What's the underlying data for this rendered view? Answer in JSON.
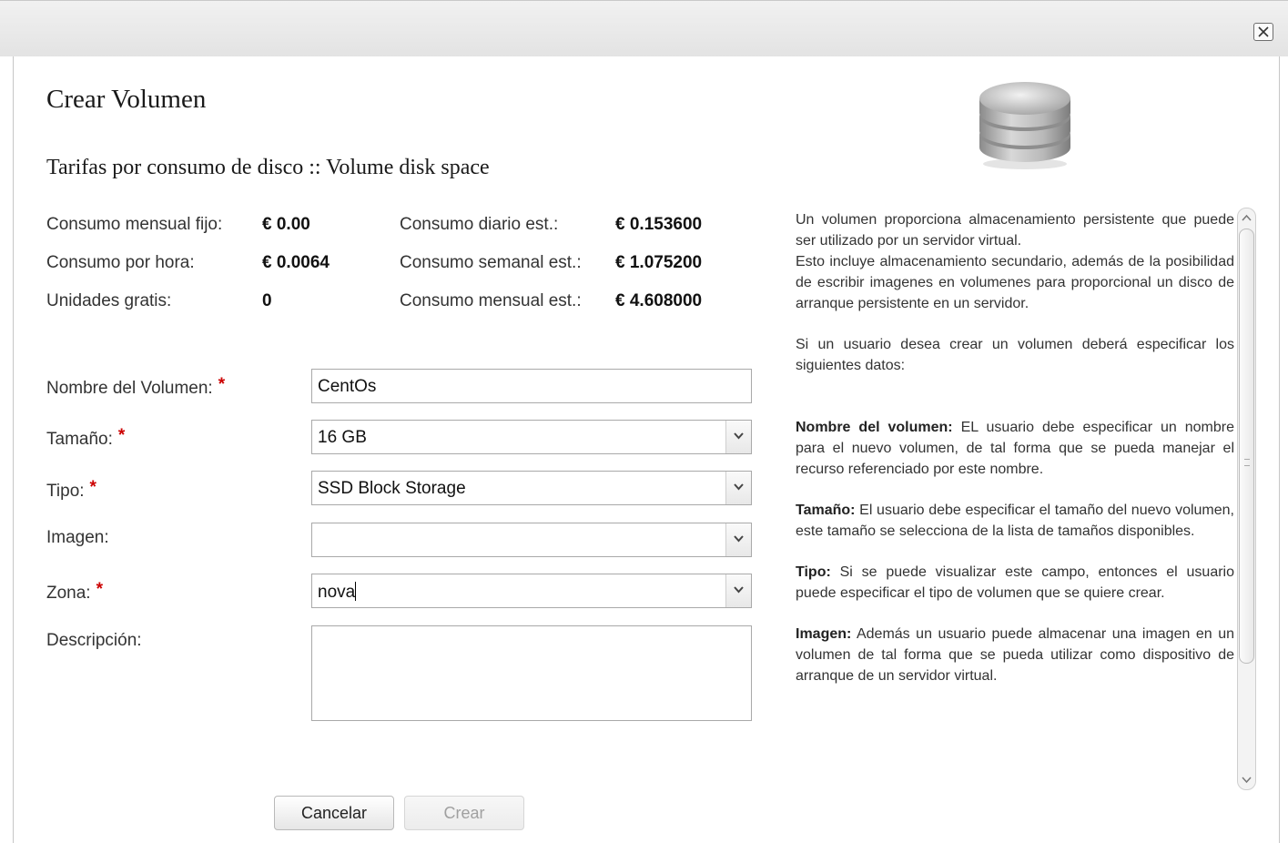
{
  "dialog": {
    "title": "Crear Volumen",
    "subtitle": "Tarifas por consumo de disco :: Volume disk space"
  },
  "rates": {
    "monthly_fixed_label": "Consumo mensual fijo:",
    "monthly_fixed_value": "€ 0.00",
    "hourly_label": "Consumo por hora:",
    "hourly_value": "€ 0.0064",
    "free_units_label": "Unidades gratis:",
    "free_units_value": "0",
    "daily_est_label": "Consumo diario est.:",
    "daily_est_value": "€ 0.153600",
    "weekly_est_label": "Consumo semanal est.:",
    "weekly_est_value": "€ 1.075200",
    "monthly_est_label": "Consumo mensual est.:",
    "monthly_est_value": "€ 4.608000"
  },
  "form": {
    "name_label": "Nombre del Volumen:",
    "name_value": "CentOs",
    "size_label": "Tamaño:",
    "size_value": "16 GB",
    "type_label": "Tipo:",
    "type_value": "SSD Block Storage",
    "image_label": "Imagen:",
    "image_value": "",
    "zone_label": "Zona:",
    "zone_value": "nova",
    "description_label": "Descripción:",
    "description_value": "",
    "required_mark": "*"
  },
  "buttons": {
    "cancel": "Cancelar",
    "create": "Crear"
  },
  "help": {
    "intro_1": "Un volumen proporciona almacenamiento persistente que puede ser utilizado por un servidor virtual.",
    "intro_2": "Esto incluye almacenamiento secundario, además de la posibilidad de escribir imagenes en volumenes para proporcional un disco de arranque persistente en un servidor.",
    "intro_3": "Si un usuario desea crear un volumen deberá especificar los siguientes datos:",
    "name_term": "Nombre del volumen:",
    "name_desc": " EL usuario debe especificar un nombre para el nuevo volumen, de tal forma que se pueda manejar el recurso referenciado por este nombre.",
    "size_term": "Tamaño:",
    "size_desc": " El usuario debe especificar el tamaño del nuevo volumen, este tamaño se selecciona de la lista de tamaños disponibles.",
    "type_term": "Tipo:",
    "type_desc": " Si se puede visualizar este campo, entonces el usuario puede especificar el tipo de volumen que se quiere crear.",
    "image_term": "Imagen:",
    "image_desc": " Además un usuario puede almacenar una imagen en un volumen de tal forma que se pueda utilizar como dispositivo de arranque de un servidor virtual."
  },
  "icons": {
    "close": "close-icon",
    "volume": "database-icon",
    "dropdown": "chevron-down-icon"
  }
}
